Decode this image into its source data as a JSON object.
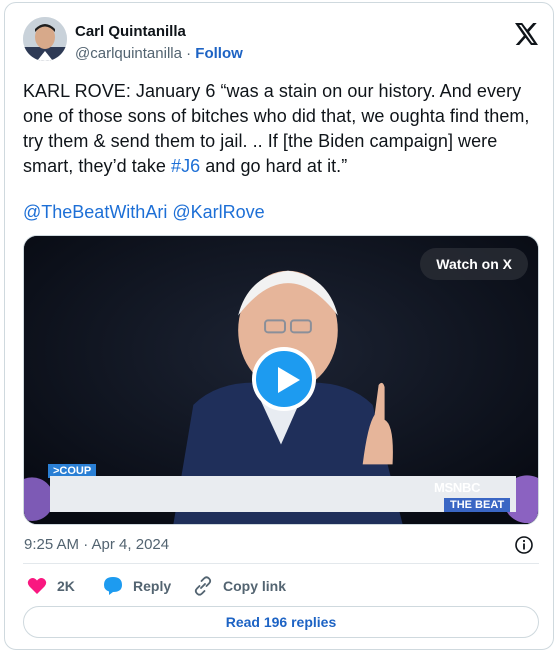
{
  "author": {
    "name": "Carl Quintanilla",
    "handle": "@carlquintanilla",
    "separator": " · ",
    "follow_label": "Follow"
  },
  "tweet": {
    "text_before": "KARL ROVE: January 6 “was a stain on our history. And every one of those sons of bitches who did that, we oughta find them, try them & send them to jail. .. If [the Biden campaign] were smart, they’d take ",
    "hashtag": "#J6",
    "text_after": " and go hard at it.”",
    "mention_1": "@TheBeatWithAri",
    "mention_2": "@KarlRove"
  },
  "media": {
    "watch_label": "Watch on X",
    "lower_third_tag": ">COUP",
    "network": "MSNBC",
    "show": "THE BEAT"
  },
  "meta": {
    "timestamp": "9:25 AM · Apr 4, 2024"
  },
  "actions": {
    "likes": "2K",
    "reply_label": "Reply",
    "copy_label": "Copy link"
  },
  "read_replies_label": "Read 196 replies",
  "colors": {
    "accent": "#1d9bf0",
    "like": "#f91880",
    "link": "#1d6fd6"
  }
}
